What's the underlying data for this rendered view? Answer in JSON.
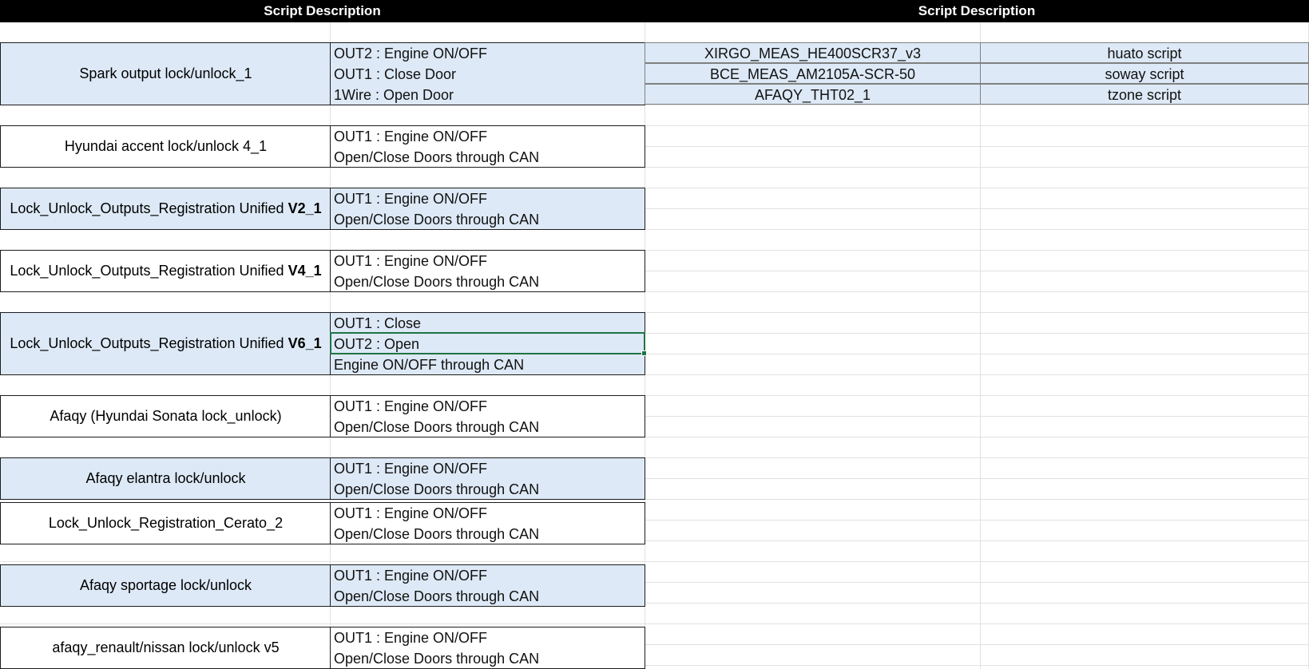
{
  "headers": {
    "left": "Script Description",
    "right": "Script Description"
  },
  "scripts": [
    {
      "name": "Spark output lock/unlock_1",
      "lines": [
        "OUT2 : Engine ON/OFF",
        "OUT1 : Close Door",
        "1Wire : Open Door"
      ]
    },
    {
      "name": "Hyundai accent lock/unlock 4_1",
      "lines": [
        "OUT1 : Engine ON/OFF",
        "Open/Close Doors through CAN"
      ]
    },
    {
      "name_prefix": "Lock_Unlock_Outputs_Registration Unified ",
      "name_bold": "V2_1",
      "lines": [
        "OUT1 : Engine ON/OFF",
        "Open/Close Doors through CAN"
      ]
    },
    {
      "name_prefix": "Lock_Unlock_Outputs_Registration Unified ",
      "name_bold": "V4_1",
      "lines": [
        "OUT1 : Engine ON/OFF",
        "Open/Close Doors through CAN"
      ]
    },
    {
      "name_prefix": "Lock_Unlock_Outputs_Registration Unified ",
      "name_bold": "V6_1",
      "lines": [
        "OUT1 : Close",
        "OUT2 : Open",
        "Engine ON/OFF through CAN"
      ]
    },
    {
      "name": "Afaqy (Hyundai Sonata lock_unlock)",
      "lines": [
        "OUT1 : Engine ON/OFF",
        "Open/Close Doors through CAN"
      ]
    },
    {
      "name": "Afaqy elantra lock/unlock",
      "lines": [
        "OUT1 : Engine ON/OFF",
        "Open/Close Doors through CAN"
      ]
    },
    {
      "name": "Lock_Unlock_Registration_Cerato_2",
      "lines": [
        "OUT1 : Engine ON/OFF",
        "Open/Close Doors through CAN"
      ]
    },
    {
      "name": "Afaqy sportage lock/unlock",
      "lines": [
        "OUT1 : Engine ON/OFF",
        "Open/Close Doors through CAN"
      ]
    },
    {
      "name": "afaqy_renault/nissan lock/unlock v5",
      "lines": [
        "OUT1 : Engine ON/OFF",
        "Open/Close Doors through CAN"
      ]
    }
  ],
  "other_scripts": [
    {
      "id": "XIRGO_MEAS_HE400SCR37_v3",
      "desc": "huato script"
    },
    {
      "id": "BCE_MEAS_AM2105A-SCR-50",
      "desc": "soway script"
    },
    {
      "id": "AFAQY_THT02_1",
      "desc": "tzone script"
    }
  ]
}
